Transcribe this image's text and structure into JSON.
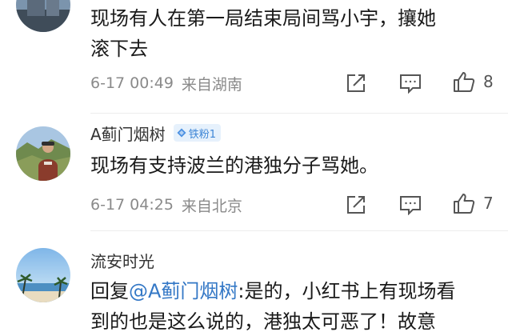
{
  "comments": [
    {
      "username": "",
      "text_lines": [
        "现场有人在第一局结束局间骂小宇，攘她",
        "滚下去"
      ],
      "time": "6-17 00:49",
      "location": "来自湖南",
      "likes": "8"
    },
    {
      "username": "A蓟门烟树",
      "badge": "铁粉1",
      "text_lines": [
        "现场有支持波兰的港独分子骂她。"
      ],
      "time": "6-17 04:25",
      "location": "来自北京",
      "likes": "7"
    },
    {
      "username": "流安时光",
      "reply_prefix": "回复",
      "reply_mention": "@A蓟门烟树",
      "reply_rest": ":是的，小红书上有现场看",
      "text_line2": "到的也是这么说的，港独太可恶了！故意"
    }
  ],
  "colors": {
    "mention": "#3478c6",
    "badge_bg": "#e6f1fc",
    "badge_text": "#3e86d6",
    "meta_text": "#8a8a8a"
  },
  "icons": [
    "share-icon",
    "comment-icon",
    "like-icon",
    "diamond-icon"
  ]
}
